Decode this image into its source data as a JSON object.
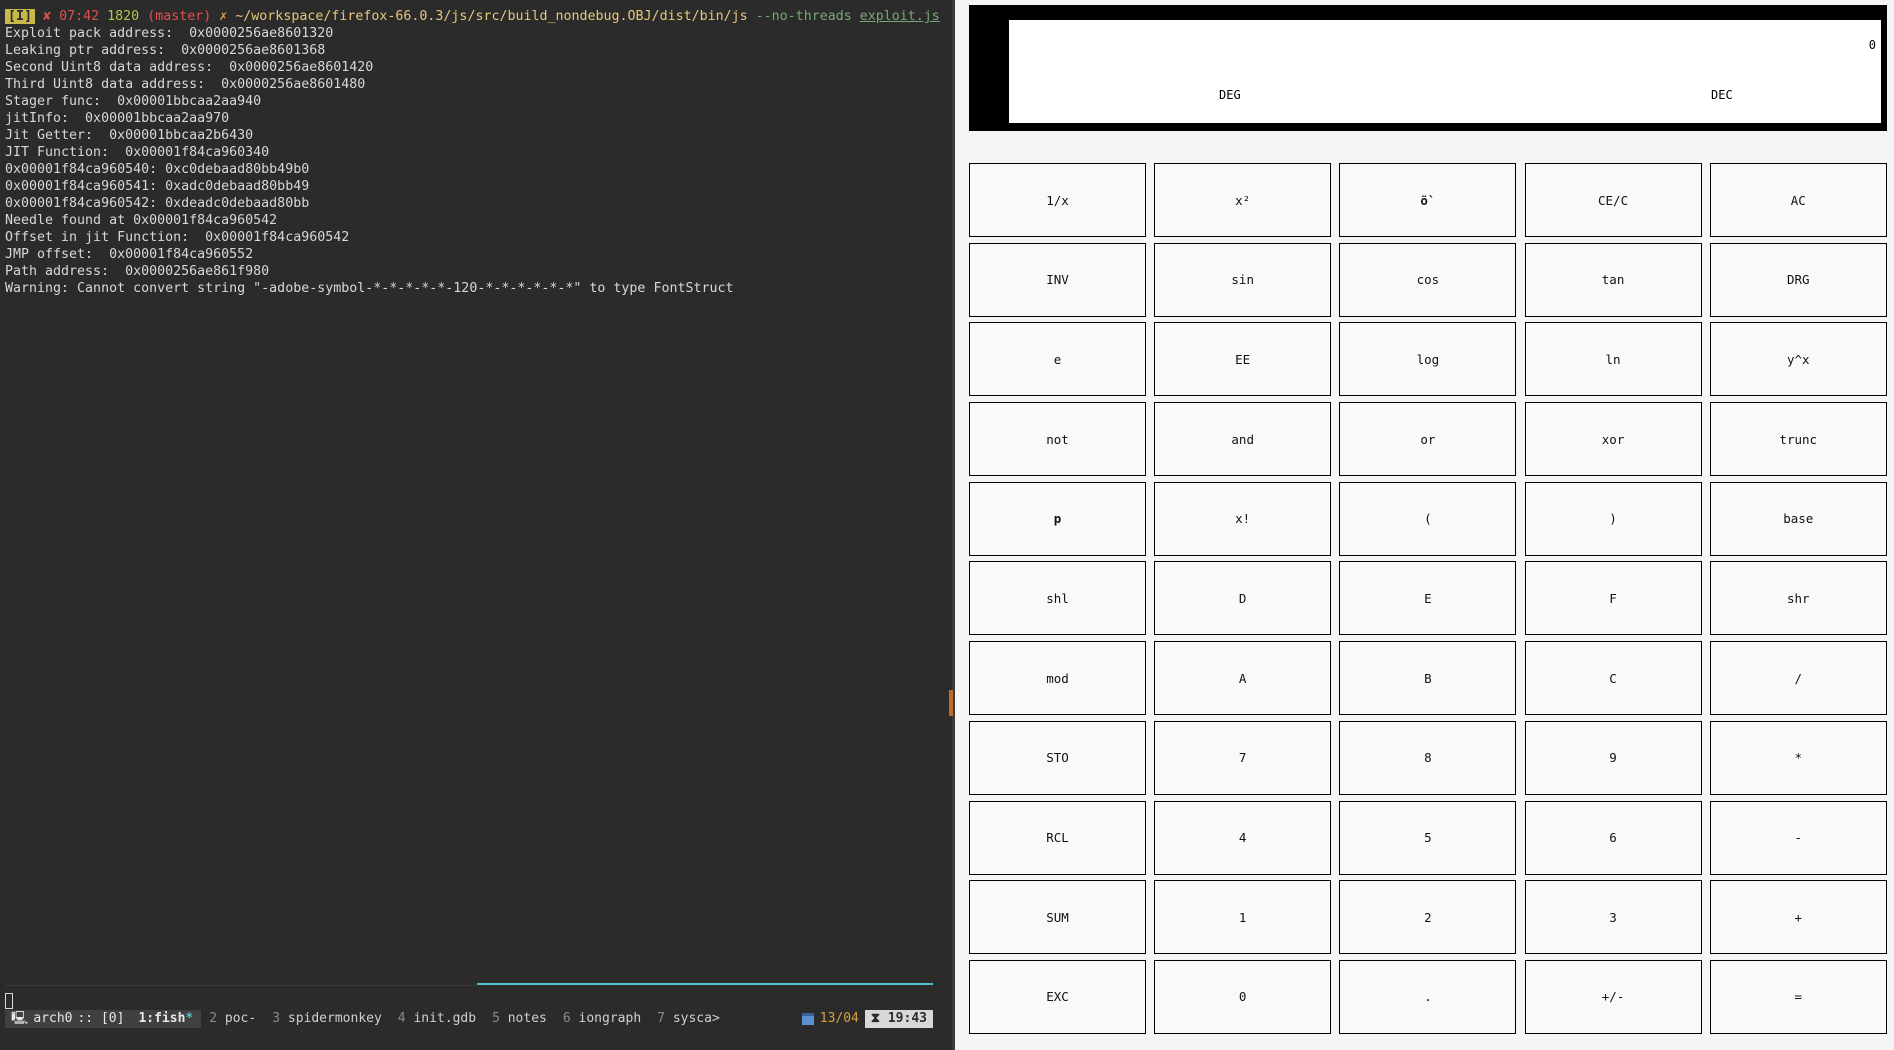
{
  "terminal": {
    "prompt": {
      "mode": "I",
      "status_mark": "✘",
      "time": "07:42",
      "history_num": "1820",
      "branch": "(master)",
      "dirty_mark": "✗",
      "path": "~/workspace/firefox-66.0.3/js/src/build_nondebug.OBJ/dist/bin/js",
      "flag": "--no-threads",
      "script": "exploit.js"
    },
    "output_lines": [
      "Exploit pack address:  0x0000256ae8601320",
      "Leaking ptr address:  0x0000256ae8601368",
      "Second Uint8 data address:  0x0000256ae8601420",
      "Third Uint8 data address:  0x0000256ae8601480",
      "Stager func:  0x00001bbcaa2aa940",
      "jitInfo:  0x00001bbcaa2aa970",
      "Jit Getter:  0x00001bbcaa2b6430",
      "JIT Function:  0x00001f84ca960340",
      "0x00001f84ca960540: 0xc0debaad80bb49b0",
      "0x00001f84ca960541: 0xadc0debaad80bb49",
      "0x00001f84ca960542: 0xdeadc0debaad80bb",
      "Needle found at 0x00001f84ca960542",
      "Offset in jit Function:  0x00001f84ca960542",
      "JMP offset:  0x00001f84ca960552",
      "Path address:  0x0000256ae861f980",
      "Warning: Cannot convert string \"-adobe-symbol-*-*-*-*-*-120-*-*-*-*-*-*\" to type FontStruct"
    ]
  },
  "statusbar": {
    "session": "arch0",
    "session_sep": ":: [0]",
    "windows": [
      {
        "index": "1",
        "name": "fish",
        "mark": "*",
        "active": true
      },
      {
        "index": "2",
        "name": "poc-",
        "mark": "",
        "active": false
      },
      {
        "index": "3",
        "name": "spidermonkey",
        "mark": "",
        "active": false
      },
      {
        "index": "4",
        "name": "init.gdb",
        "mark": "",
        "active": false
      },
      {
        "index": "5",
        "name": "notes",
        "mark": "",
        "active": false
      },
      {
        "index": "6",
        "name": "iongraph",
        "mark": "",
        "active": false
      },
      {
        "index": "7",
        "name": "sysca>",
        "mark": "",
        "active": false
      }
    ],
    "date": "13/04",
    "clock_icon": "⧗",
    "clock": "19:43"
  },
  "calculator": {
    "display": {
      "value": "0",
      "angle_mode": "DEG",
      "radix_mode": "DEC"
    },
    "keys": [
      {
        "label": "1/x",
        "name": "reciprocal"
      },
      {
        "label": "x²",
        "name": "square"
      },
      {
        "label": "ö`",
        "name": "sqrt",
        "bold": true
      },
      {
        "label": "CE/C",
        "name": "clear-entry"
      },
      {
        "label": "AC",
        "name": "all-clear"
      },
      {
        "label": "INV",
        "name": "inverse"
      },
      {
        "label": "sin",
        "name": "sin"
      },
      {
        "label": "cos",
        "name": "cos"
      },
      {
        "label": "tan",
        "name": "tan"
      },
      {
        "label": "DRG",
        "name": "drg"
      },
      {
        "label": "e",
        "name": "e"
      },
      {
        "label": "EE",
        "name": "ee"
      },
      {
        "label": "log",
        "name": "log"
      },
      {
        "label": "ln",
        "name": "ln"
      },
      {
        "label": "y^x",
        "name": "power"
      },
      {
        "label": "not",
        "name": "not"
      },
      {
        "label": "and",
        "name": "and"
      },
      {
        "label": "or",
        "name": "or"
      },
      {
        "label": "xor",
        "name": "xor"
      },
      {
        "label": "trunc",
        "name": "trunc"
      },
      {
        "label": "p",
        "name": "pi",
        "bold": true
      },
      {
        "label": "x!",
        "name": "factorial"
      },
      {
        "label": "(",
        "name": "open-paren"
      },
      {
        "label": ")",
        "name": "close-paren"
      },
      {
        "label": "base",
        "name": "base"
      },
      {
        "label": "shl",
        "name": "shl"
      },
      {
        "label": "D",
        "name": "hex-d"
      },
      {
        "label": "E",
        "name": "hex-e"
      },
      {
        "label": "F",
        "name": "hex-f"
      },
      {
        "label": "shr",
        "name": "shr"
      },
      {
        "label": "mod",
        "name": "mod"
      },
      {
        "label": "A",
        "name": "hex-a"
      },
      {
        "label": "B",
        "name": "hex-b"
      },
      {
        "label": "C",
        "name": "hex-c"
      },
      {
        "label": "/",
        "name": "divide"
      },
      {
        "label": "STO",
        "name": "store"
      },
      {
        "label": "7",
        "name": "digit-7"
      },
      {
        "label": "8",
        "name": "digit-8"
      },
      {
        "label": "9",
        "name": "digit-9"
      },
      {
        "label": "*",
        "name": "multiply"
      },
      {
        "label": "RCL",
        "name": "recall"
      },
      {
        "label": "4",
        "name": "digit-4"
      },
      {
        "label": "5",
        "name": "digit-5"
      },
      {
        "label": "6",
        "name": "digit-6"
      },
      {
        "label": "-",
        "name": "subtract"
      },
      {
        "label": "SUM",
        "name": "sum"
      },
      {
        "label": "1",
        "name": "digit-1"
      },
      {
        "label": "2",
        "name": "digit-2"
      },
      {
        "label": "3",
        "name": "digit-3"
      },
      {
        "label": "+",
        "name": "add"
      },
      {
        "label": "EXC",
        "name": "exchange"
      },
      {
        "label": "0",
        "name": "digit-0"
      },
      {
        "label": ".",
        "name": "decimal-point"
      },
      {
        "label": "+/-",
        "name": "negate"
      },
      {
        "label": "=",
        "name": "equals"
      }
    ]
  }
}
